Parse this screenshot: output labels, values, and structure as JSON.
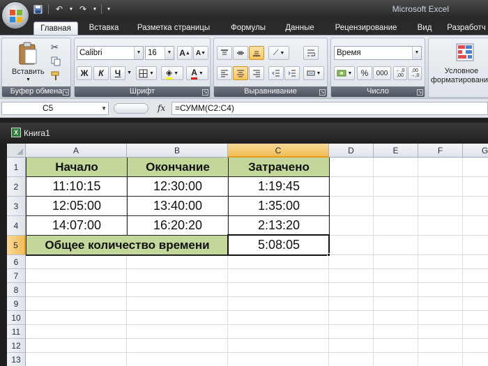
{
  "app": {
    "title": "Microsoft Excel"
  },
  "quick_access": {
    "save_icon": "save-icon",
    "undo_icon": "undo-icon",
    "redo_icon": "redo-icon",
    "customize_icon": "chevron-down-icon"
  },
  "tabs": [
    {
      "label": "Главная",
      "active": true
    },
    {
      "label": "Вставка"
    },
    {
      "label": "Разметка страницы"
    },
    {
      "label": "Формулы"
    },
    {
      "label": "Данные"
    },
    {
      "label": "Рецензирование"
    },
    {
      "label": "Вид"
    },
    {
      "label": "Разработч"
    }
  ],
  "ribbon": {
    "clipboard": {
      "label": "Буфер обмена",
      "paste_label": "Вставить"
    },
    "font": {
      "label": "Шрифт",
      "font_name": "Calibri",
      "font_size": "16",
      "bold": "Ж",
      "italic": "К",
      "underline": "Ч",
      "grow": "A",
      "shrink": "A"
    },
    "alignment": {
      "label": "Выравнивание"
    },
    "number": {
      "label": "Число",
      "format": "Время",
      "percent": "%",
      "thousands": "000"
    },
    "styles": {
      "conditional_label_1": "Условное",
      "conditional_label_2": "форматирование"
    }
  },
  "formula_bar": {
    "name_box": "C5",
    "fx": "fx",
    "formula": "=СУММ(C2:C4)"
  },
  "workbook": {
    "title": "Книга1"
  },
  "sheet": {
    "columns": [
      "A",
      "B",
      "C",
      "D",
      "E",
      "F",
      "G"
    ],
    "selected_column": "C",
    "rows": [
      "1",
      "2",
      "3",
      "4",
      "5",
      "6",
      "7",
      "8",
      "9",
      "10",
      "11",
      "12",
      "13"
    ],
    "selected_row": "5",
    "header": [
      "Начало",
      "Окончание",
      "Затрачено"
    ],
    "data": [
      [
        "11:10:15",
        "12:30:00",
        "1:19:45"
      ],
      [
        "12:05:00",
        "13:40:00",
        "1:35:00"
      ],
      [
        "14:07:00",
        "16:20:20",
        "2:13:20"
      ]
    ],
    "total_label": "Общее количество времени",
    "total_value": "5:08:05",
    "active_cell": "C5",
    "header_fill": "#c4d79b",
    "selection_color": "#f1bd55"
  }
}
